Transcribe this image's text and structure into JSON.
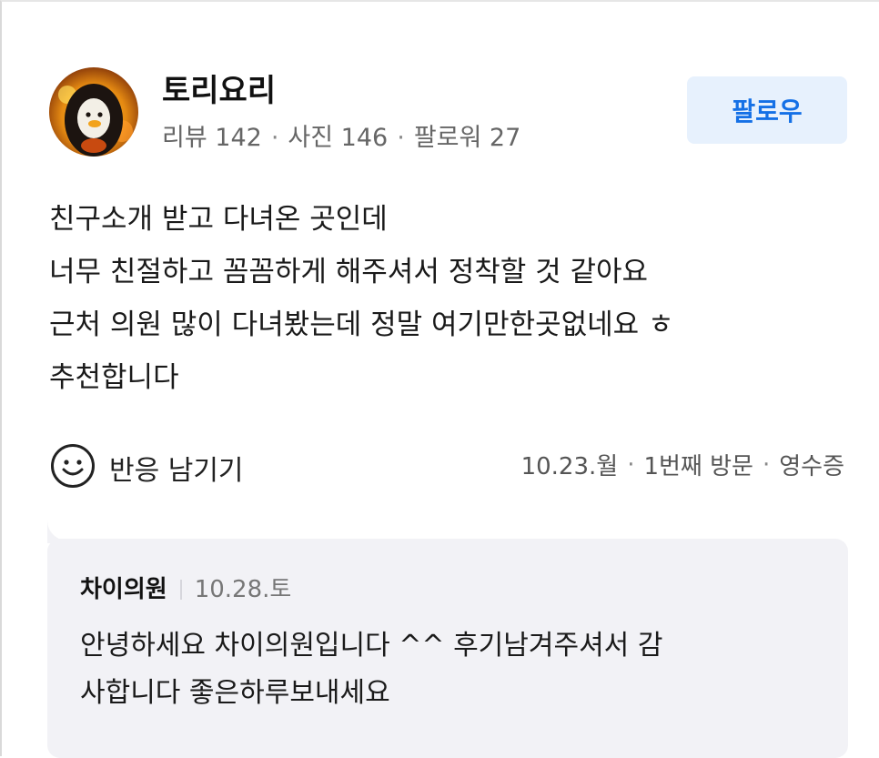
{
  "profile": {
    "nickname": "토리요리",
    "reviews": "리뷰 142",
    "photos": "사진 146",
    "followers": "팔로워 27",
    "separator": "·"
  },
  "follow_button": {
    "label": "팔로우"
  },
  "review": {
    "lines": [
      "친구소개 받고 다녀온 곳인데",
      "너무 친절하고 꼼꼼하게 해주셔서 정착할 것 같아요",
      "근처 의원 많이 다녀봤는데 정말 여기만한곳없네요 ㅎ",
      "추천합니다"
    ]
  },
  "reaction": {
    "label": "반응 남기기",
    "icon": "smile-icon"
  },
  "visit_meta": {
    "date": "10.23.월",
    "visit_count": "1번째 방문",
    "verification": "영수증",
    "separator": "·"
  },
  "owner_reply": {
    "owner": "차이의원",
    "date": "10.28.토",
    "lines": [
      "안녕하세요 차이의원입니다 ^^ 후기남겨주셔서 감",
      "사합니다 좋은하루보내세요"
    ]
  },
  "colors": {
    "accent": "#1470e6",
    "follow_bg": "#e7f1fd",
    "reply_bg": "#f2f2f6",
    "meta_text": "#555555"
  }
}
